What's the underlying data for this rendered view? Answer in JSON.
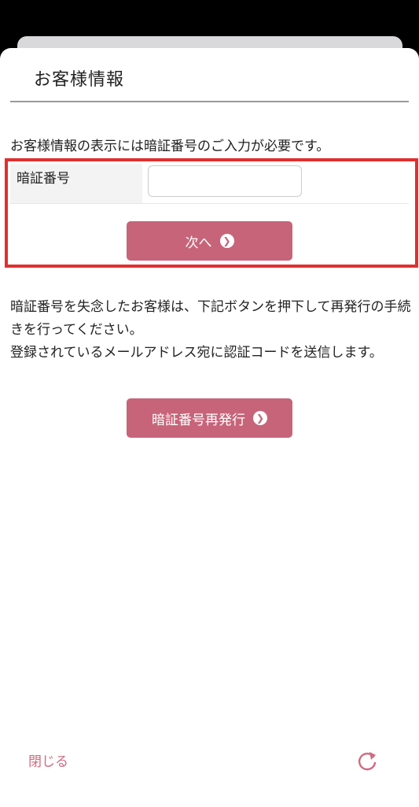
{
  "header": {
    "title": "お客様情報"
  },
  "intro_text": "お客様情報の表示には暗証番号のご入力が必要です。",
  "pin_form": {
    "label": "暗証番号",
    "input_value": "",
    "input_placeholder": "",
    "next_button_label": "次へ"
  },
  "reissue_notice": {
    "line1": "暗証番号を失念したお客様は、下記ボタンを押下して再発行の手続きを行ってください。",
    "line2": "登録されているメールアドレス宛に認証コードを送信します。"
  },
  "reissue_button_label": "暗証番号再発行",
  "footer": {
    "close_label": "閉じる",
    "refresh_icon": "refresh-icon"
  },
  "colors": {
    "button": "#c76479",
    "link": "#d06a80",
    "highlight": "#e0302f"
  }
}
